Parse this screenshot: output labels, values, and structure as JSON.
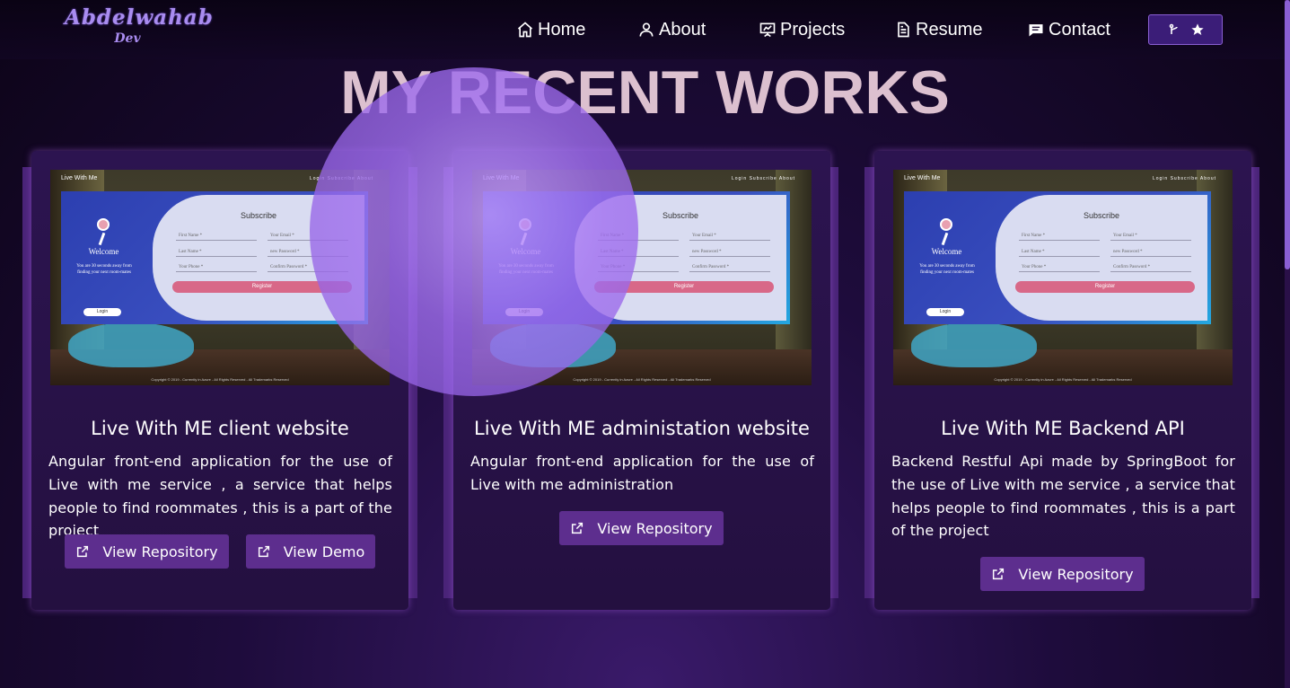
{
  "brand": {
    "name": "Abdelwahab",
    "sub": "Dev"
  },
  "nav": {
    "home": "Home",
    "about": "About",
    "projects": "Projects",
    "resume": "Resume",
    "contact": "Contact"
  },
  "github_button": {
    "icons": [
      "git-fork-icon",
      "star-icon"
    ]
  },
  "section_title": "MY RECENT WORKS",
  "thumbnail": {
    "app_name": "Live With Me",
    "links": "Login   Subscribe   About",
    "welcome": "Welcome",
    "welcome_sub": "You are 30 seconds away from finding your next room-mates",
    "login": "Login",
    "subscribe": "Subscribe",
    "fields": [
      "First Name *",
      "Your Email *",
      "Last Name *",
      "new Password *",
      "Your Phone *",
      "Confirm Password *"
    ],
    "register": "Register",
    "copyright": "Copyright © 2019 - Currently in Azure - All Rights Reserved - All Trademarks Reserved"
  },
  "projects": [
    {
      "title": "Live With ME client website",
      "description": "Angular front-end application for the use of Live with me service , a service that helps people to find roommates , this is a part of the project",
      "buttons": [
        "View Repository",
        "View Demo"
      ]
    },
    {
      "title": "Live With ME administation website",
      "description": "Angular front-end application for the use of Live with me administration",
      "buttons": [
        "View Repository"
      ]
    },
    {
      "title": "Live With ME Backend API",
      "description": "Backend Restful Api made by SpringBoot for the use of Live with me service , a service that helps people to find roommates , this is a part of the project",
      "buttons": [
        "View Repository"
      ]
    }
  ],
  "colors": {
    "accent": "#5d2e8e",
    "brand": "#a98cf0",
    "title": "#dcc0cf",
    "card": "#2c1450",
    "orb": "#a070f0"
  }
}
